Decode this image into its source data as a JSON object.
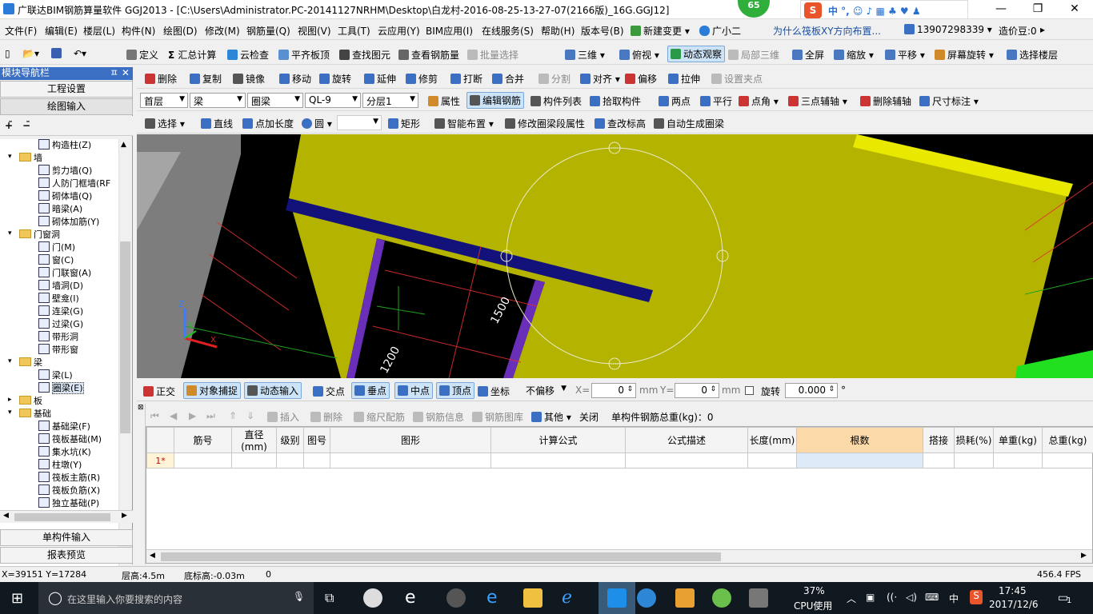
{
  "window": {
    "title": "广联达BIM钢筋算量软件 GGJ2013 - [C:\\Users\\Administrator.PC-20141127NRHM\\Desktop\\白龙村-2016-08-25-13-27-07(2166版)_16G.GGJ12]",
    "badge": "65",
    "minimize": "—",
    "maximize": "❐",
    "close": "✕"
  },
  "menubar": {
    "items": [
      "文件(F)",
      "编辑(E)",
      "楼层(L)",
      "构件(N)",
      "绘图(D)",
      "修改(M)",
      "钢筋量(Q)",
      "视图(V)",
      "工具(T)",
      "云应用(Y)",
      "BIM应用(I)",
      "在线服务(S)",
      "帮助(H)",
      "版本号(B)"
    ],
    "new_change": "新建变更",
    "assistant": "广小二",
    "question": "为什么筏板XY方向布置...",
    "phone": "13907298339",
    "bean": "造价豆:0"
  },
  "toolbar1": {
    "items": [
      "定义",
      "汇总计算",
      "云检查",
      "平齐板顶",
      "查找图元",
      "查看钢筋量",
      "批量选择",
      "三维",
      "俯视",
      "动态观察",
      "局部三维",
      "全屏",
      "缩放",
      "平移",
      "屏幕旋转",
      "选择楼层"
    ]
  },
  "toolbar2": {
    "items": [
      "删除",
      "复制",
      "镜像",
      "移动",
      "旋转",
      "延伸",
      "修剪",
      "打断",
      "合并",
      "分割",
      "对齐",
      "偏移",
      "拉伸",
      "设置夹点"
    ]
  },
  "toolbar3": {
    "floor": "首层",
    "category": "梁",
    "type": "圈梁",
    "component": "QL-9",
    "layer": "分层1",
    "items": [
      "属性",
      "编辑钢筋",
      "构件列表",
      "拾取构件",
      "两点",
      "平行",
      "点角",
      "三点辅轴",
      "删除辅轴",
      "尺寸标注"
    ]
  },
  "toolbar4": {
    "items": [
      "选择",
      "直线",
      "点加长度",
      "圆",
      "矩形",
      "智能布置",
      "修改圈梁段属性",
      "查改标高",
      "自动生成圈梁"
    ]
  },
  "leftpanel": {
    "header": "模块导航栏",
    "pin": "ㅍ ✕",
    "btn_settings": "工程设置",
    "btn_drawing": "绘图输入",
    "btn_single": "单构件输入",
    "btn_report": "报表预览",
    "tree": [
      {
        "label": "构造柱(Z)",
        "level": 2,
        "folder": false
      },
      {
        "label": "墙",
        "level": 1,
        "folder": true,
        "toggle": "−"
      },
      {
        "label": "剪力墙(Q)",
        "level": 2,
        "folder": false
      },
      {
        "label": "人防门框墙(RF",
        "level": 2,
        "folder": false
      },
      {
        "label": "砌体墙(Q)",
        "level": 2,
        "folder": false
      },
      {
        "label": "暗梁(A)",
        "level": 2,
        "folder": false
      },
      {
        "label": "砌体加筋(Y)",
        "level": 2,
        "folder": false
      },
      {
        "label": "门窗洞",
        "level": 1,
        "folder": true,
        "toggle": "−"
      },
      {
        "label": "门(M)",
        "level": 2,
        "folder": false
      },
      {
        "label": "窗(C)",
        "level": 2,
        "folder": false
      },
      {
        "label": "门联窗(A)",
        "level": 2,
        "folder": false
      },
      {
        "label": "墙洞(D)",
        "level": 2,
        "folder": false
      },
      {
        "label": "壁龛(I)",
        "level": 2,
        "folder": false
      },
      {
        "label": "连梁(G)",
        "level": 2,
        "folder": false
      },
      {
        "label": "过梁(G)",
        "level": 2,
        "folder": false
      },
      {
        "label": "带形洞",
        "level": 2,
        "folder": false
      },
      {
        "label": "带形窗",
        "level": 2,
        "folder": false
      },
      {
        "label": "梁",
        "level": 1,
        "folder": true,
        "toggle": "−"
      },
      {
        "label": "梁(L)",
        "level": 2,
        "folder": false
      },
      {
        "label": "圈梁(E)",
        "level": 2,
        "folder": false,
        "selected": true
      },
      {
        "label": "板",
        "level": 1,
        "folder": true,
        "toggle": "+"
      },
      {
        "label": "基础",
        "level": 1,
        "folder": true,
        "toggle": "−"
      },
      {
        "label": "基础梁(F)",
        "level": 2,
        "folder": false
      },
      {
        "label": "筏板基础(M)",
        "level": 2,
        "folder": false
      },
      {
        "label": "集水坑(K)",
        "level": 2,
        "folder": false
      },
      {
        "label": "柱墩(Y)",
        "level": 2,
        "folder": false
      },
      {
        "label": "筏板主筋(R)",
        "level": 2,
        "folder": false
      },
      {
        "label": "筏板负筋(X)",
        "level": 2,
        "folder": false
      },
      {
        "label": "独立基础(P)",
        "level": 2,
        "folder": false
      }
    ]
  },
  "canvas": {
    "dim1": "1500",
    "dim2": "1200",
    "axis_z": "Z",
    "axis_y": "Y",
    "axis_x": "X"
  },
  "snapbar": {
    "items": [
      "正交",
      "对象捕捉",
      "动态输入",
      "交点",
      "垂点",
      "中点",
      "顶点",
      "坐标"
    ],
    "offset_mode": "不偏移",
    "x_label": "X=",
    "x_value": "0",
    "y_label": "Y=",
    "y_value": "0",
    "unit": "mm",
    "rotate_label": "旋转",
    "rotate_value": "0.000",
    "degree": "°"
  },
  "grid_toolbar": {
    "items": [
      "插入",
      "删除",
      "缩尺配筋",
      "钢筋信息",
      "钢筋图库",
      "其他",
      "关闭"
    ],
    "total": "单构件钢筋总重(kg)：0"
  },
  "grid": {
    "columns": [
      "筋号",
      "直径(mm)",
      "级别",
      "图号",
      "图形",
      "计算公式",
      "公式描述",
      "长度(mm)",
      "根数",
      "搭接",
      "损耗(%)",
      "单重(kg)",
      "总重(kg)"
    ],
    "rows": [
      {
        "index": "1*",
        "cells": [
          "",
          "",
          "",
          "",
          "",
          "",
          "",
          "",
          "",
          "",
          "",
          "",
          ""
        ]
      }
    ]
  },
  "statusbar": {
    "coords": "X=39151 Y=17284",
    "floor_height": "层高:4.5m",
    "bottom_elev": "底标高:-0.03m",
    "zero": "0",
    "fps": "456.4 FPS"
  },
  "taskbar": {
    "search_placeholder": "在这里输入你要搜索的内容",
    "cpu_percent": "37%",
    "cpu_label": "CPU使用",
    "ime": "中",
    "time": "17:45",
    "date": "2017/12/6",
    "notifications": "1"
  },
  "colors": {
    "canvas_bg": "#000000",
    "slab": "#b4b400",
    "beam": "#10107a",
    "wall": "#6a2fb8",
    "titlebar_highlight": "#3a6fc4"
  }
}
